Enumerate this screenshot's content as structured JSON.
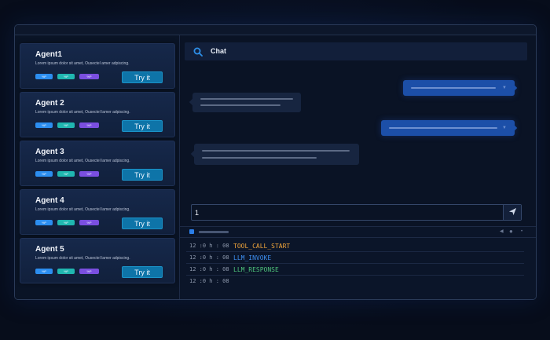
{
  "agents": [
    {
      "name": "Agent1",
      "description": "Lorem ipsum dolor sit amet, Ousectel amer adpiscing.",
      "tags": [
        "%P",
        "%P",
        "%P"
      ],
      "button": "Try it"
    },
    {
      "name": "Agent 2",
      "description": "Lorem ipsum dolor sit amet, Ousectel lamer adpiscing.",
      "tags": [
        "%P",
        "%P",
        "%P"
      ],
      "button": "Try it"
    },
    {
      "name": "Agent 3",
      "description": "Lorem ipsum dolor sit amet, Ousectel lamer adpiscing.",
      "tags": [
        "%P",
        "%P",
        "%P"
      ],
      "button": "Try it"
    },
    {
      "name": "Agent 4",
      "description": "Lorem ipsum dolor sit amet, Ousectel lamer adpiscing.",
      "tags": [
        "%P",
        "%P",
        "%P"
      ],
      "button": "Try it"
    },
    {
      "name": "Agent 5",
      "description": "Lorem ipsum dolor sit amet, Ousectel lamer adpiscing.",
      "tags": [
        "%P",
        "%P",
        "%P"
      ],
      "button": "Try it"
    }
  ],
  "chat": {
    "title": "Chat",
    "icon": "search-icon",
    "input_value": "1",
    "send_icon": "send-icon"
  },
  "log": {
    "entries": [
      {
        "time": "12 :0 h : 08",
        "event": "TOOL_CALL_START",
        "color": "#f0a43a"
      },
      {
        "time": "12 :0 h : 08",
        "event": "LLM_INVOKE",
        "color": "#3d8ef0"
      },
      {
        "time": "12 :0 h : 08",
        "event": "LLM_RESPONSE",
        "color": "#4ec27a"
      },
      {
        "time": "12 :0 h : 08",
        "event": "",
        "color": "#8d98ac"
      }
    ]
  },
  "colors": {
    "accent": "#1c4fa8",
    "button": "#0e74a8",
    "tag_blue": "#2c8ef0",
    "tag_teal": "#20b7b0",
    "tag_purple": "#7a4fe0"
  }
}
